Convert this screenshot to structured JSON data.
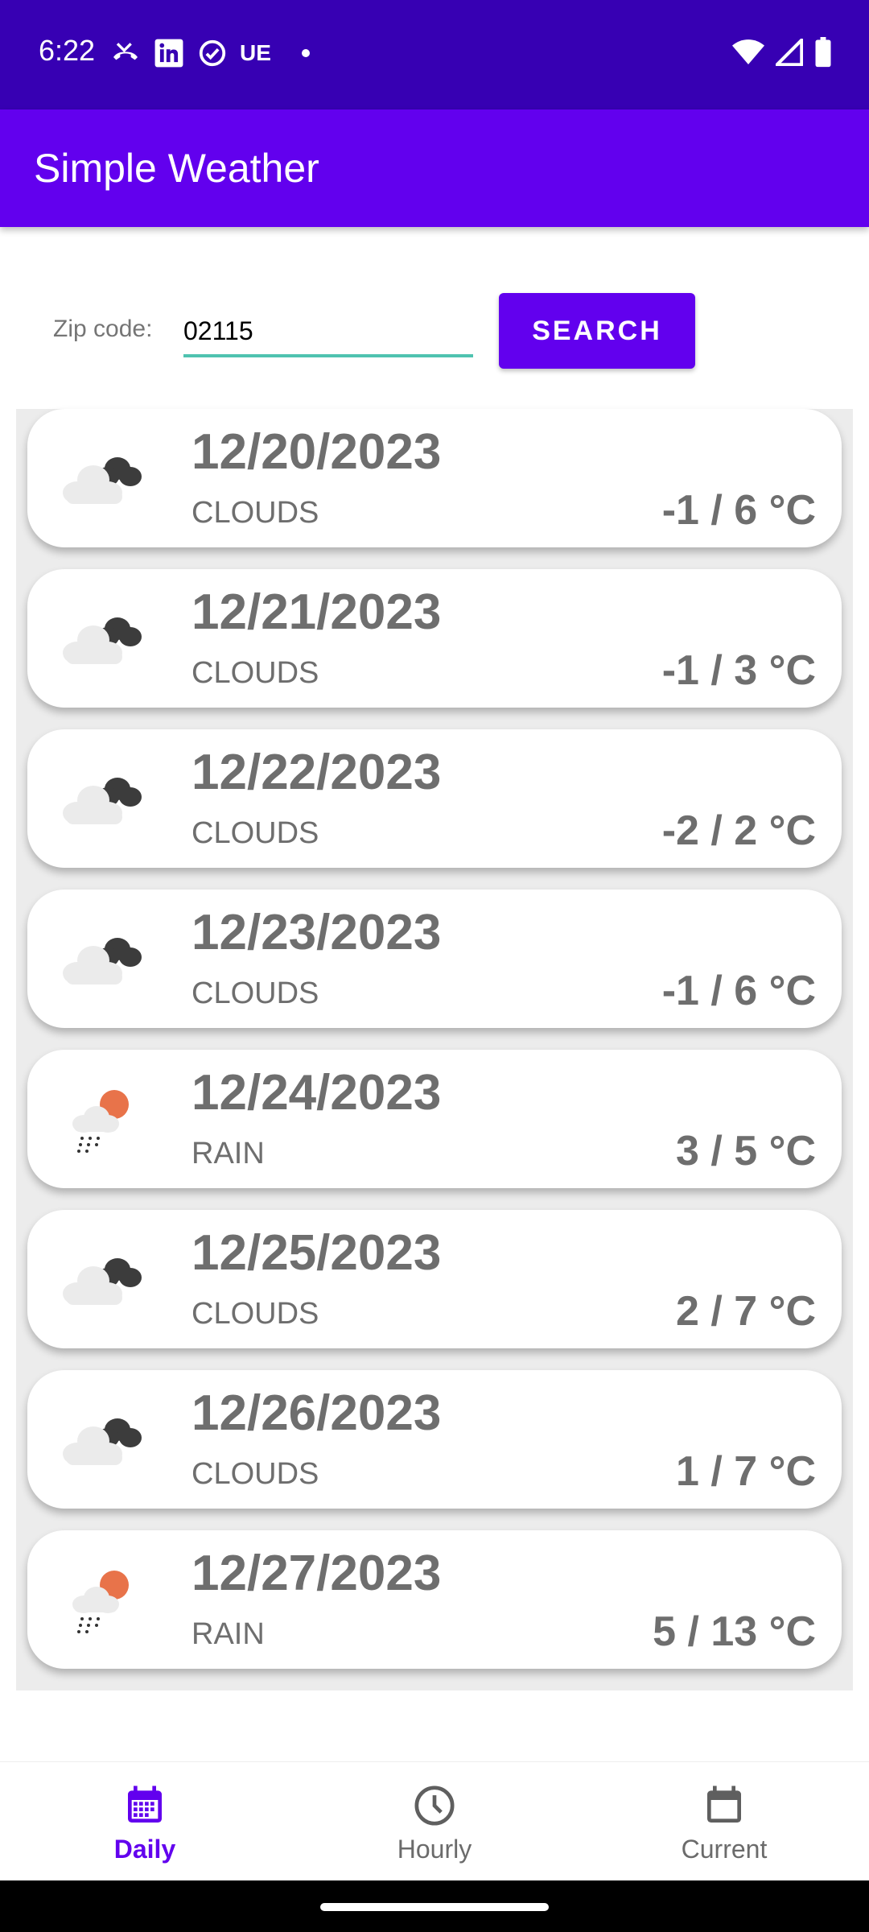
{
  "status_bar": {
    "time": "6:22",
    "carrier": "UE",
    "icons_left": [
      "phone-missed-icon",
      "linkedin-icon",
      "check-circle-icon"
    ],
    "icons_right": [
      "wifi-icon",
      "signal-icon",
      "battery-icon"
    ]
  },
  "app_bar": {
    "title": "Simple Weather"
  },
  "search": {
    "label": "Zip code:",
    "value": "02115",
    "button_label": "SEARCH"
  },
  "forecast": [
    {
      "date": "12/20/2023",
      "condition": "CLOUDS",
      "temp": "-1 / 6 °C",
      "icon": "clouds-icon"
    },
    {
      "date": "12/21/2023",
      "condition": "CLOUDS",
      "temp": "-1 / 3 °C",
      "icon": "clouds-icon"
    },
    {
      "date": "12/22/2023",
      "condition": "CLOUDS",
      "temp": "-2 / 2 °C",
      "icon": "clouds-icon"
    },
    {
      "date": "12/23/2023",
      "condition": "CLOUDS",
      "temp": "-1 / 6 °C",
      "icon": "clouds-icon"
    },
    {
      "date": "12/24/2023",
      "condition": "RAIN",
      "temp": "3 / 5 °C",
      "icon": "rain-icon"
    },
    {
      "date": "12/25/2023",
      "condition": "CLOUDS",
      "temp": "2 / 7 °C",
      "icon": "clouds-icon"
    },
    {
      "date": "12/26/2023",
      "condition": "CLOUDS",
      "temp": "1 / 7 °C",
      "icon": "clouds-icon"
    },
    {
      "date": "12/27/2023",
      "condition": "RAIN",
      "temp": "5 / 13 °C",
      "icon": "rain-icon"
    }
  ],
  "bottom_nav": [
    {
      "label": "Daily",
      "icon": "calendar-grid-icon",
      "active": true
    },
    {
      "label": "Hourly",
      "icon": "clock-icon",
      "active": false
    },
    {
      "label": "Current",
      "icon": "calendar-icon",
      "active": false
    }
  ],
  "colors": {
    "status_bar": "#3700b3",
    "primary": "#6200ee",
    "input_underline": "#4fc3b0",
    "text_gray": "#6e6e6e"
  }
}
